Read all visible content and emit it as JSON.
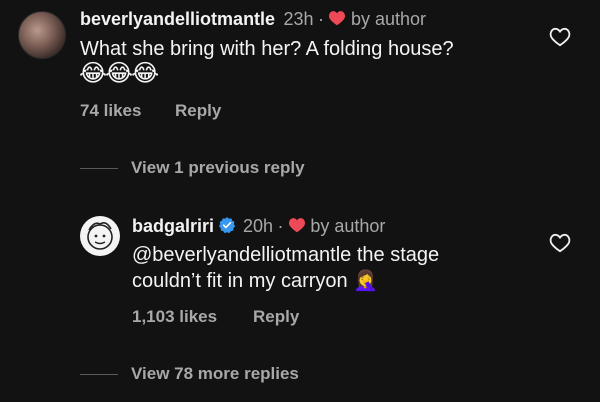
{
  "comments": [
    {
      "username": "beverlyandelliotmantle",
      "time": "23h",
      "separator": "·",
      "author_badge": "by author",
      "text": "What she bring with her? A folding house?",
      "emoji": "😂😂😂",
      "likes": "74 likes",
      "reply_label": "Reply"
    },
    {
      "username": "badgalriri",
      "verified": true,
      "time": "20h",
      "separator": "·",
      "author_badge": "by author",
      "mention": "@beverlyandelliotmantle",
      "text_line1_rest": " the stage",
      "text_line2": "couldn’t fit in my carryon",
      "emoji": "🤦‍♀️",
      "likes": "1,103 likes",
      "reply_label": "Reply"
    }
  ],
  "thread": {
    "view_previous": "View 1 previous reply",
    "view_more": "View 78 more replies"
  },
  "colors": {
    "background": "#121212",
    "heart_red": "#ed4956",
    "verified_blue": "#3897f0",
    "secondary_text": "#a8a8a8"
  },
  "icons": {
    "like": "heart-outline-icon",
    "author_like": "heart-filled-icon",
    "verified": "verified-badge-icon"
  }
}
